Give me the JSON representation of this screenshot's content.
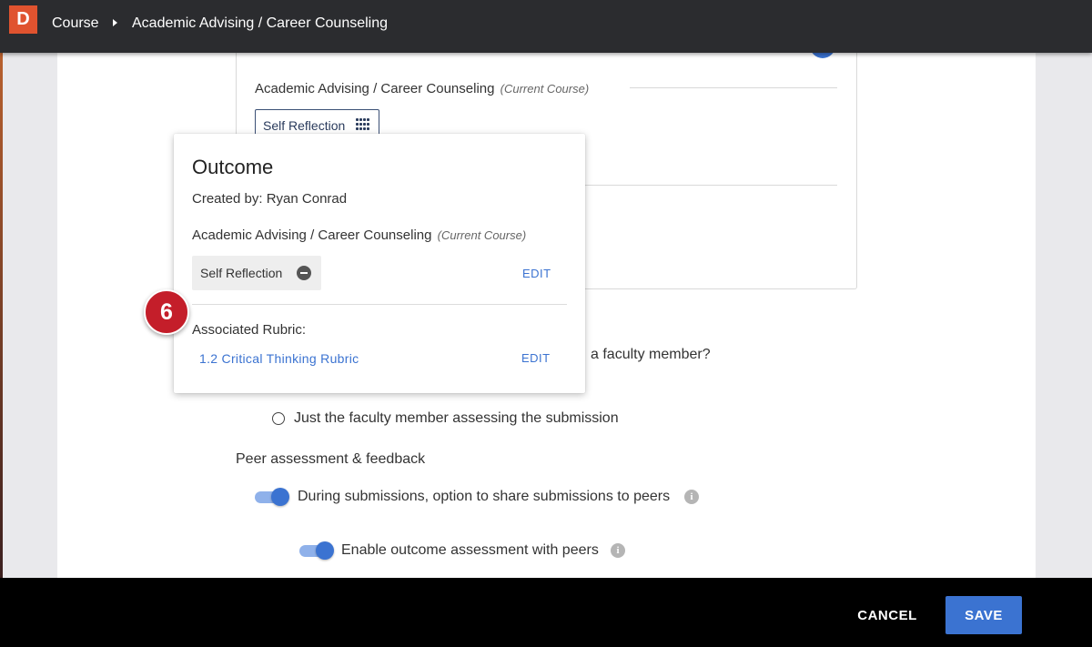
{
  "header": {
    "logo": "D",
    "breadcrumb": [
      "Course",
      "Academic Advising / Career Counseling"
    ]
  },
  "card": {
    "course_name": "Academic Advising / Career Counseling",
    "course_tag": "(Current Course)",
    "chip_label": "Self Reflection",
    "chip_icon": "rubric-grid-icon"
  },
  "form": {
    "question_partial": "a faculty member?",
    "radio_option": "Just the faculty member assessing the submission",
    "peer_section_title": "Peer assessment & feedback",
    "toggle_share": "During submissions, option to share submissions to peers",
    "toggle_share_on": true,
    "toggle_outcome": "Enable outcome assessment with peers",
    "toggle_outcome_on": true
  },
  "popover": {
    "title": "Outcome",
    "created_by": "Created by: Ryan Conrad",
    "course_name": "Academic Advising / Career Counseling",
    "course_tag": "(Current Course)",
    "chip_label": "Self Reflection",
    "edit_label": "EDIT",
    "rubric_label": "Associated Rubric:",
    "rubric_link": "1.2 Critical Thinking Rubric",
    "rubric_edit_label": "EDIT"
  },
  "step_badge": "6",
  "footer": {
    "cancel_label": "CANCEL",
    "save_label": "SAVE"
  },
  "colors": {
    "accent": "#3b73d1",
    "badge": "#c41e2a",
    "logo": "#e0532f"
  }
}
